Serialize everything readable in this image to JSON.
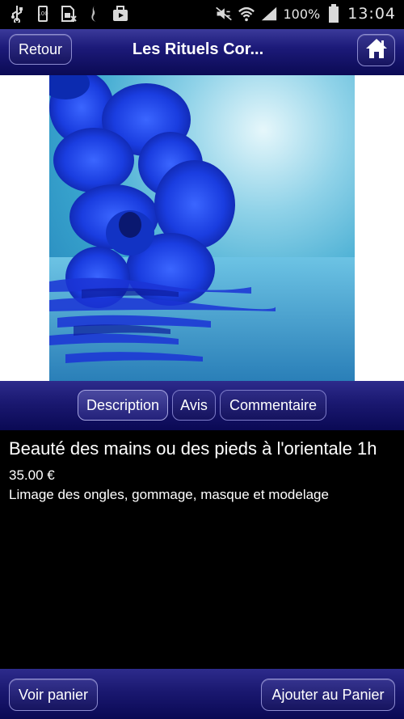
{
  "status_bar": {
    "battery_small_label": "100",
    "battery_percent": "100%",
    "time": "13:04",
    "icons": [
      "usb-icon",
      "battery-icon",
      "sim-card-icon",
      "flame-icon",
      "bag-icon",
      "mute-icon",
      "wifi-icon",
      "signal-icon"
    ]
  },
  "header": {
    "back_label": "Retour",
    "title": "Les Rituels Cor...",
    "home_icon": "home-icon"
  },
  "tabs": [
    {
      "label": "Description",
      "active": true
    },
    {
      "label": "Avis",
      "active": false
    },
    {
      "label": "Commentaire",
      "active": false
    }
  ],
  "product": {
    "title": "Beauté des mains ou des pieds à l'orientale 1h",
    "price": "35.00 €",
    "description": "Limage des ongles, gommage, masque et modelage"
  },
  "footer": {
    "cart_label": "Voir panier",
    "add_label": "Ajouter au Panier"
  },
  "colors": {
    "bar_top": "#2d2b8c",
    "bar_bottom": "#0a0954",
    "background": "#000000",
    "orchid": "#1a3de0"
  }
}
